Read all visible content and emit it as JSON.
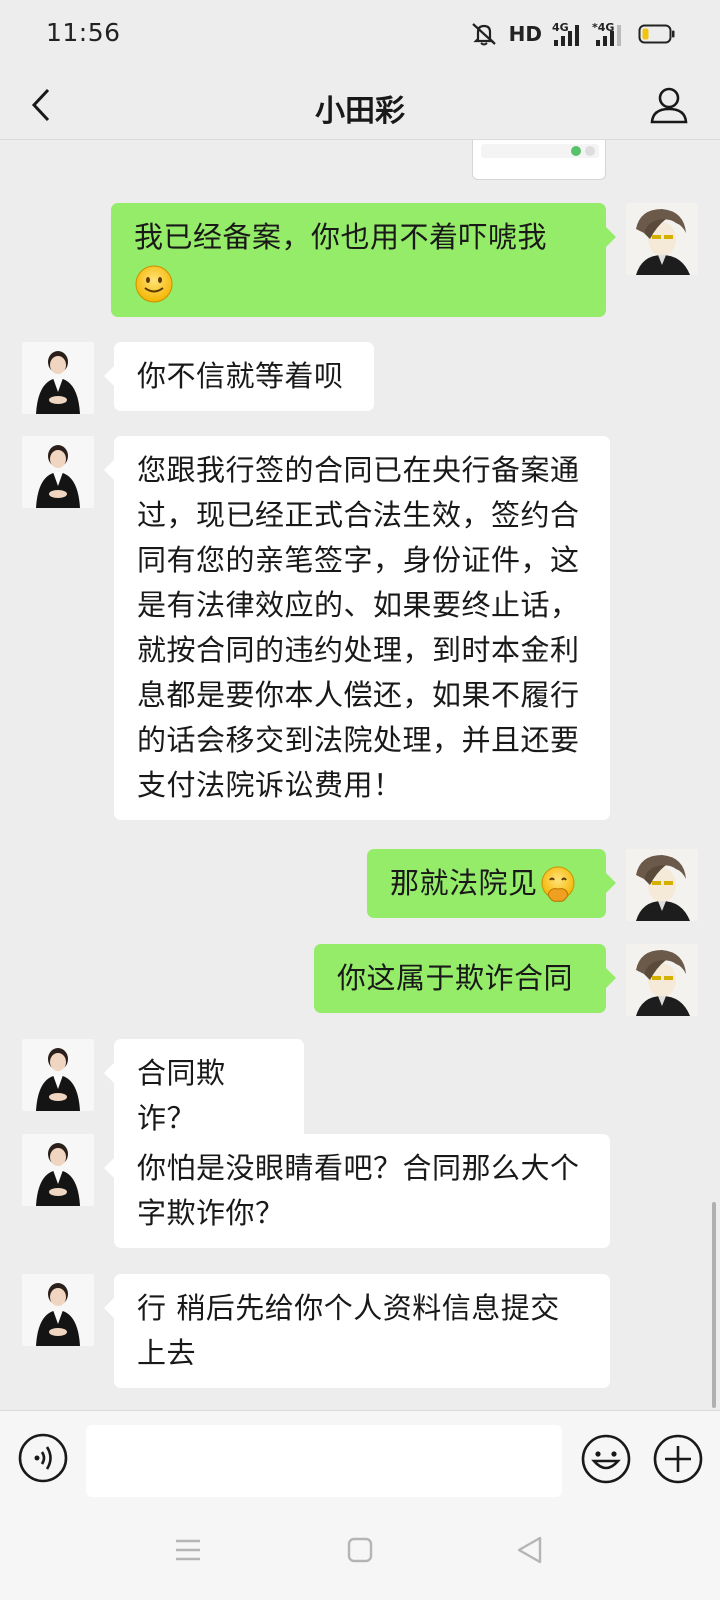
{
  "status": {
    "time": "11:56",
    "hd": "HD",
    "network1": "4G",
    "network2": "4G"
  },
  "header": {
    "title": "小田彩"
  },
  "messages": [
    {
      "side": "out",
      "text": "我已经备案，你也用不着吓唬我",
      "emoji": "smiling-face-emoji"
    },
    {
      "side": "in",
      "text": "你不信就等着呗"
    },
    {
      "side": "in",
      "text": "您跟我行签的合同已在央行备案通过，现已经正式合法生效，签约合同有您的亲笔签字，身份证件，这是有法律效应的、如果要终止话，就按合同的违约处理，到时本金利息都是要你本人偿还，如果不履行的话会移交到法院处理，并且还要支付法院诉讼费用！"
    },
    {
      "side": "out",
      "text": "那就法院见",
      "emoji": "hand-over-mouth-emoji"
    },
    {
      "side": "out",
      "text": "你这属于欺诈合同"
    },
    {
      "side": "in",
      "text": "合同欺诈？"
    },
    {
      "side": "in",
      "text": "你怕是没眼睛看吧？合同那么大个字欺诈你？"
    },
    {
      "side": "in",
      "text": "行 稍后先给你个人资料信息提交上去"
    }
  ],
  "input": {
    "value": "",
    "placeholder": ""
  },
  "icons": {
    "back": "chevron-left-icon",
    "profile": "person-icon",
    "voice": "voice-icon",
    "emoji": "emoji-icon",
    "plus": "plus-icon",
    "menu": "menu-icon",
    "home": "home-icon",
    "back_nav": "triangle-back-icon"
  },
  "colors": {
    "outgoing_bubble": "#95ec69",
    "incoming_bubble": "#ffffff",
    "background": "#ededed"
  }
}
